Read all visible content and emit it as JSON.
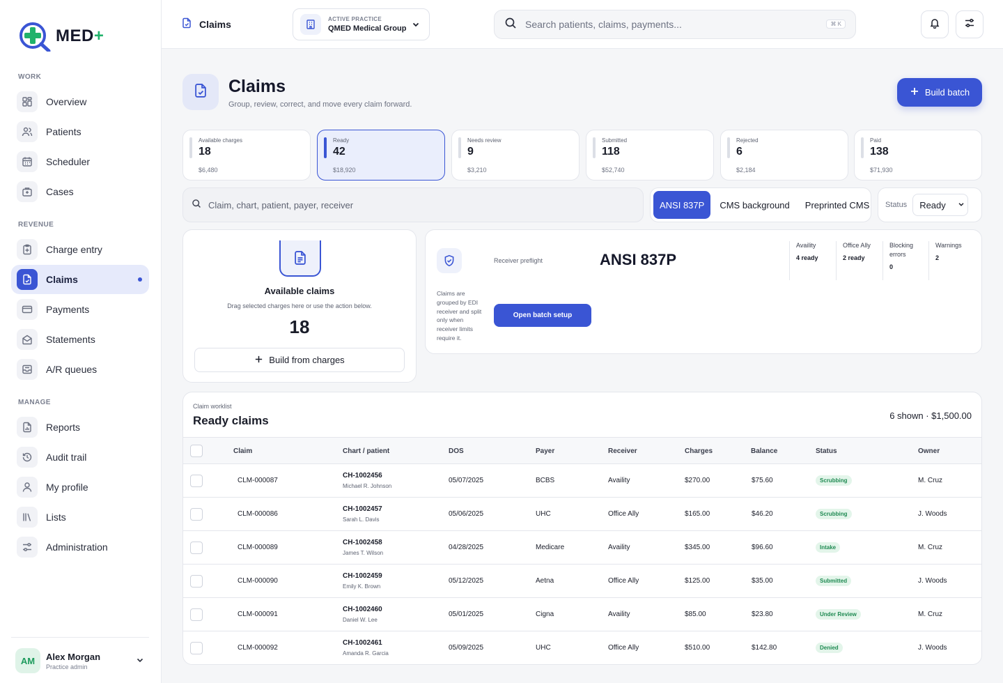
{
  "brand": {
    "name": "MED",
    "plus": "+"
  },
  "sidebar": {
    "sections": {
      "work": "WORK",
      "revenue": "REVENUE",
      "manage": "MANAGE"
    },
    "items": [
      {
        "label": "Overview",
        "icon": "grid-icon"
      },
      {
        "label": "Patients",
        "icon": "users-icon"
      },
      {
        "label": "Scheduler",
        "icon": "calendar-icon"
      },
      {
        "label": "Cases",
        "icon": "briefcase-medical-icon"
      },
      {
        "label": "Charge entry",
        "icon": "clipboard-plus-icon"
      },
      {
        "label": "Claims",
        "icon": "file-check-icon",
        "active": true
      },
      {
        "label": "Payments",
        "icon": "credit-card-icon"
      },
      {
        "label": "Statements",
        "icon": "envelope-open-icon"
      },
      {
        "label": "A/R queues",
        "icon": "inbox-icon"
      },
      {
        "label": "Reports",
        "icon": "file-chart-icon"
      },
      {
        "label": "Audit trail",
        "icon": "history-icon"
      },
      {
        "label": "My profile",
        "icon": "user-icon"
      },
      {
        "label": "Lists",
        "icon": "library-icon"
      },
      {
        "label": "Administration",
        "icon": "sliders-icon"
      }
    ],
    "user": {
      "initials": "AM",
      "name": "Alex Morgan",
      "role": "Practice admin"
    }
  },
  "topbar": {
    "title": "Claims",
    "practice_label": "ACTIVE PRACTICE",
    "practice_value": "QMED Medical Group",
    "search_placeholder": "Search patients, claims, payments...",
    "search_shortcut": "⌘ K"
  },
  "header": {
    "title": "Claims",
    "subtitle": "Group, review, correct, and move every claim forward.",
    "build_batch": "Build batch"
  },
  "stats": [
    {
      "label": "Available charges",
      "value": "18",
      "amount": "$6,480"
    },
    {
      "label": "Ready",
      "value": "42",
      "amount": "$18,920",
      "active": true
    },
    {
      "label": "Needs review",
      "value": "9",
      "amount": "$3,210"
    },
    {
      "label": "Submitted",
      "value": "118",
      "amount": "$52,740"
    },
    {
      "label": "Rejected",
      "value": "6",
      "amount": "$2,184"
    },
    {
      "label": "Paid",
      "value": "138",
      "amount": "$71,930"
    }
  ],
  "filters": {
    "search_placeholder": "Claim, chart, patient, payer, receiver",
    "formats": [
      "ANSI 837P",
      "CMS background",
      "Preprinted CMS"
    ],
    "active_format": "ANSI 837P",
    "status_label": "Status",
    "status_value": "Ready"
  },
  "available": {
    "title": "Available claims",
    "description": "Drag selected charges here or use the action below.",
    "count": "18",
    "action": "Build from charges"
  },
  "preflight": {
    "label": "Receiver preflight",
    "value": "ANSI 837P",
    "note": "Claims are grouped by EDI receiver and split only when receiver limits require it.",
    "action": "Open batch setup",
    "metrics": [
      {
        "key": "Availity",
        "value": "4 ready"
      },
      {
        "key": "Office Ally",
        "value": "2 ready"
      },
      {
        "key": "Blocking errors",
        "value": "0"
      },
      {
        "key": "Warnings",
        "value": "2"
      }
    ]
  },
  "worklist": {
    "kicker": "Claim worklist",
    "title": "Ready claims",
    "summary": "6 shown · $1,500.00",
    "columns": [
      "Claim",
      "Chart / patient",
      "DOS",
      "Payer",
      "Receiver",
      "Charges",
      "Balance",
      "Status",
      "Owner"
    ],
    "rows": [
      {
        "claim": "CLM-000087",
        "chart": "CH-1002456",
        "patient": "Michael R. Johnson",
        "dos": "05/07/2025",
        "payer": "BCBS",
        "receiver": "Availity",
        "charges": "$270.00",
        "balance": "$75.60",
        "status": "Scrubbing",
        "owner": "M. Cruz"
      },
      {
        "claim": "CLM-000086",
        "chart": "CH-1002457",
        "patient": "Sarah L. Davis",
        "dos": "05/06/2025",
        "payer": "UHC",
        "receiver": "Office Ally",
        "charges": "$165.00",
        "balance": "$46.20",
        "status": "Scrubbing",
        "owner": "J. Woods"
      },
      {
        "claim": "CLM-000089",
        "chart": "CH-1002458",
        "patient": "James T. Wilson",
        "dos": "04/28/2025",
        "payer": "Medicare",
        "receiver": "Availity",
        "charges": "$345.00",
        "balance": "$96.60",
        "status": "Intake",
        "owner": "M. Cruz"
      },
      {
        "claim": "CLM-000090",
        "chart": "CH-1002459",
        "patient": "Emily K. Brown",
        "dos": "05/12/2025",
        "payer": "Aetna",
        "receiver": "Office Ally",
        "charges": "$125.00",
        "balance": "$35.00",
        "status": "Submitted",
        "owner": "J. Woods"
      },
      {
        "claim": "CLM-000091",
        "chart": "CH-1002460",
        "patient": "Daniel W. Lee",
        "dos": "05/01/2025",
        "payer": "Cigna",
        "receiver": "Availity",
        "charges": "$85.00",
        "balance": "$23.80",
        "status": "Under Review",
        "owner": "M. Cruz"
      },
      {
        "claim": "CLM-000092",
        "chart": "CH-1002461",
        "patient": "Amanda R. Garcia",
        "dos": "05/09/2025",
        "payer": "UHC",
        "receiver": "Office Ally",
        "charges": "$510.00",
        "balance": "$142.80",
        "status": "Denied",
        "owner": "J. Woods"
      }
    ]
  },
  "colors": {
    "accent": "#3a55d4",
    "brand_green": "#20b26b",
    "badge_bg": "#e3f5ea",
    "badge_text": "#1f8a52"
  }
}
